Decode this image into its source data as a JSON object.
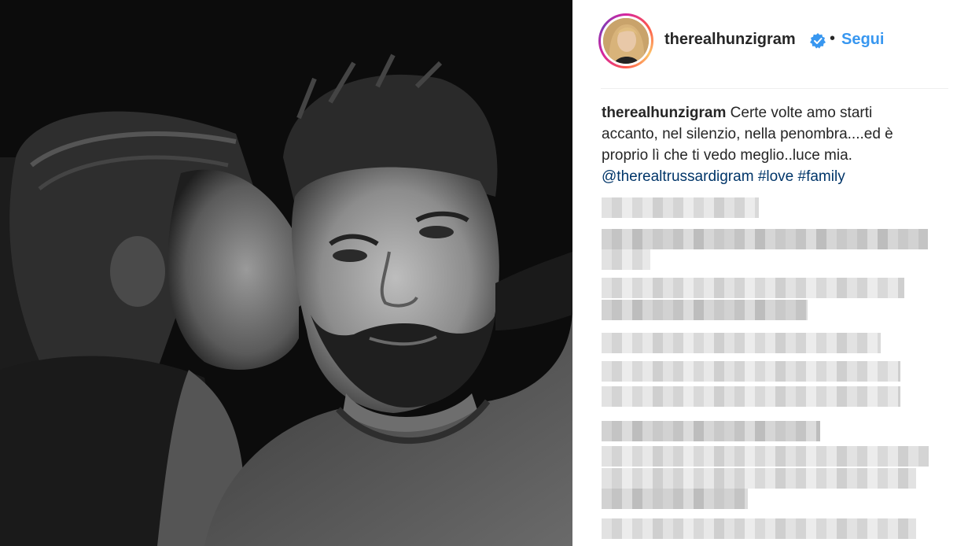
{
  "post": {
    "username": "therealhunzigram",
    "verified": true,
    "follow_label": "Segui",
    "separator": "•"
  },
  "caption": {
    "username": "therealhunzigram",
    "text": "Certe volte amo starti accanto, nel silenzio, nella penombra....ed è proprio lì che ti vedo meglio..luce mia.",
    "mention": "@therealtrussardigram",
    "hashtags": [
      "#love",
      "#family"
    ]
  },
  "colors": {
    "link": "#003569",
    "follow": "#3897f0",
    "text": "#262626",
    "verified_badge": "#3897f0"
  },
  "icons": {
    "verified": "verified-badge-icon"
  }
}
